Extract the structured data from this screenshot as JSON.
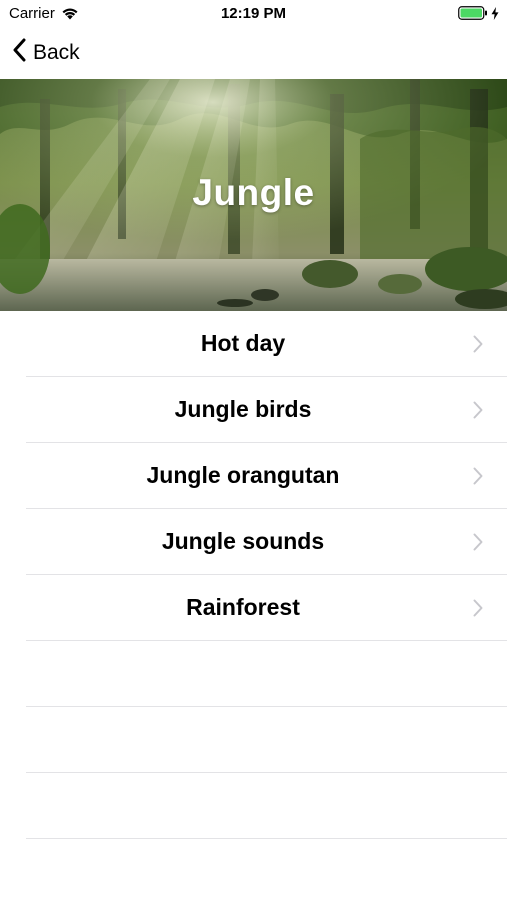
{
  "status_bar": {
    "carrier": "Carrier",
    "time": "12:19 PM",
    "battery_color": "#4cd964"
  },
  "nav": {
    "back_label": "Back"
  },
  "hero": {
    "title": "Jungle"
  },
  "list": {
    "items": [
      {
        "label": "Hot day"
      },
      {
        "label": "Jungle birds"
      },
      {
        "label": "Jungle orangutan"
      },
      {
        "label": "Jungle sounds"
      },
      {
        "label": "Rainforest"
      }
    ]
  }
}
